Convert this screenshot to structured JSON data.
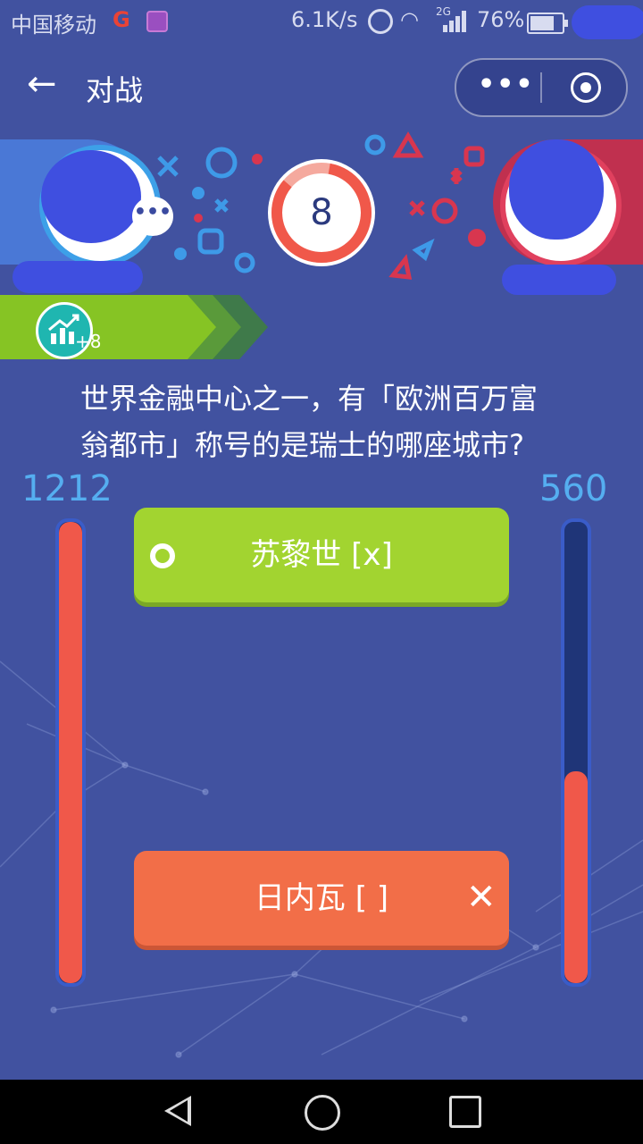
{
  "status_bar": {
    "carrier": "中国移动",
    "speed": "6.1K/s",
    "network": "2G",
    "battery": "76%"
  },
  "header": {
    "title": "对战",
    "back_icon": "back-arrow-icon",
    "menu_icon": "more-dots-icon",
    "close_icon": "target-circle-icon"
  },
  "battle": {
    "timer": "8",
    "boost_label": "+8",
    "question": "世界金融中心之一，有「欧洲百万富翁都市」称号的是瑞士的哪座城市?",
    "score_left": "1212",
    "score_right": "560",
    "score_left_fraction": 1.0,
    "score_right_fraction": 0.46,
    "answers": [
      {
        "label": "苏黎世 [x]",
        "state": "correct"
      },
      {
        "label": "日内瓦 [ ]",
        "state": "wrong"
      }
    ]
  },
  "colors": {
    "background": "#4152a0",
    "correct": "#a2d430",
    "wrong": "#f26e48",
    "score": "#55aef0"
  }
}
